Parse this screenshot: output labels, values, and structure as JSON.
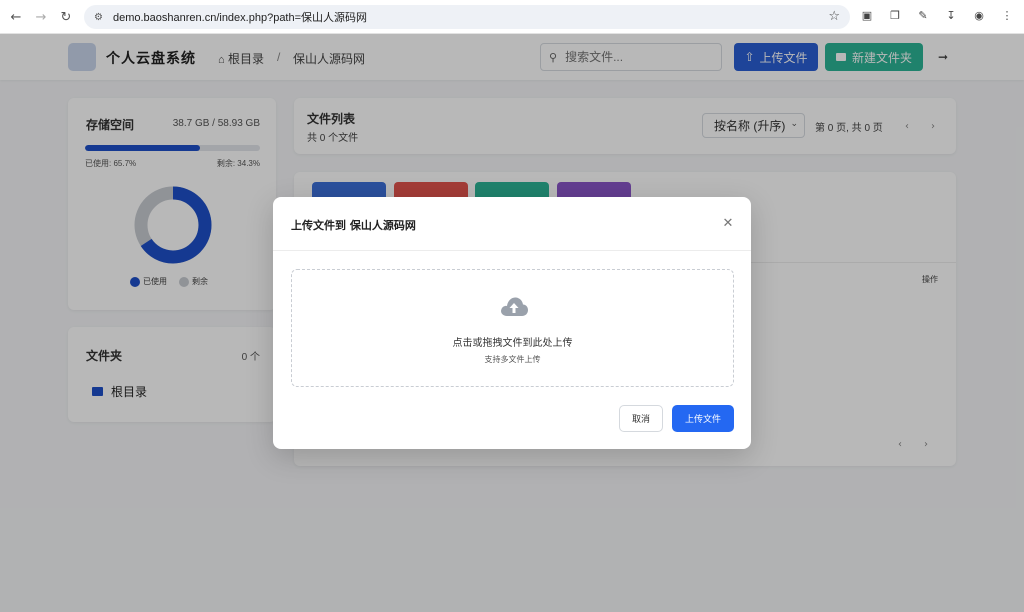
{
  "browser": {
    "url": "demo.baoshanren.cn/index.php?path=保山人源码网"
  },
  "header": {
    "app_title": "个人云盘系统",
    "breadcrumb_root": "根目录",
    "breadcrumb_separator": "/",
    "breadcrumb_current": "保山人源码网",
    "search_placeholder": "搜索文件...",
    "upload_label": "上传文件",
    "new_folder_label": "新建文件夹"
  },
  "storage": {
    "title": "存储空间",
    "usage_text": "38.7 GB / 58.93 GB",
    "used_label": "已使用: 65.7%",
    "remaining_label": "剩余: 34.3%",
    "used_fraction": 0.657,
    "legend_used": "已使用",
    "legend_remaining": "剩余",
    "used_color": "#1e4fc9",
    "remaining_color": "#c8ccd2"
  },
  "folders": {
    "title": "文件夹",
    "count": "0 个",
    "items": [
      {
        "label": "根目录"
      }
    ]
  },
  "file_list": {
    "title": "文件列表",
    "subtitle": "共 0 个文件",
    "sort_selected": "按名称 (升序)",
    "page_info": "第 0 页, 共 0 页",
    "ops_header": "操作"
  },
  "modal": {
    "title": "上传文件到 保山人源码网",
    "dropzone_main": "点击或拖拽文件到此处上传",
    "dropzone_sub": "支持多文件上传",
    "cancel_label": "取消",
    "submit_label": "上传文件"
  },
  "colors": {
    "primary": "#2a5fd4",
    "success": "#2bb596",
    "modal_primary": "#2468f2"
  }
}
